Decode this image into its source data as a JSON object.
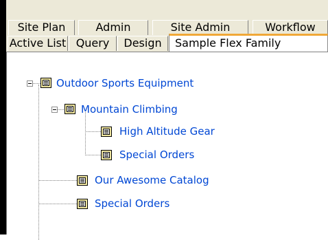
{
  "tabs": {
    "back_row": [
      "Site Plan",
      "Admin",
      "Site Admin",
      "Workflow"
    ],
    "front_row": [
      "Active List",
      "Query",
      "Design"
    ],
    "active": "Sample Flex Family"
  },
  "tree": {
    "root": "Outdoor Sports Equipment",
    "child_1": "Mountain Climbing",
    "child_1_1": "High Altitude Gear",
    "child_1_2": "Special Orders",
    "child_2": "Our Awesome Catalog",
    "child_3": "Special Orders"
  },
  "colors": {
    "link_blue": "#0047d4",
    "active_tab_accent": "#f0a838"
  }
}
